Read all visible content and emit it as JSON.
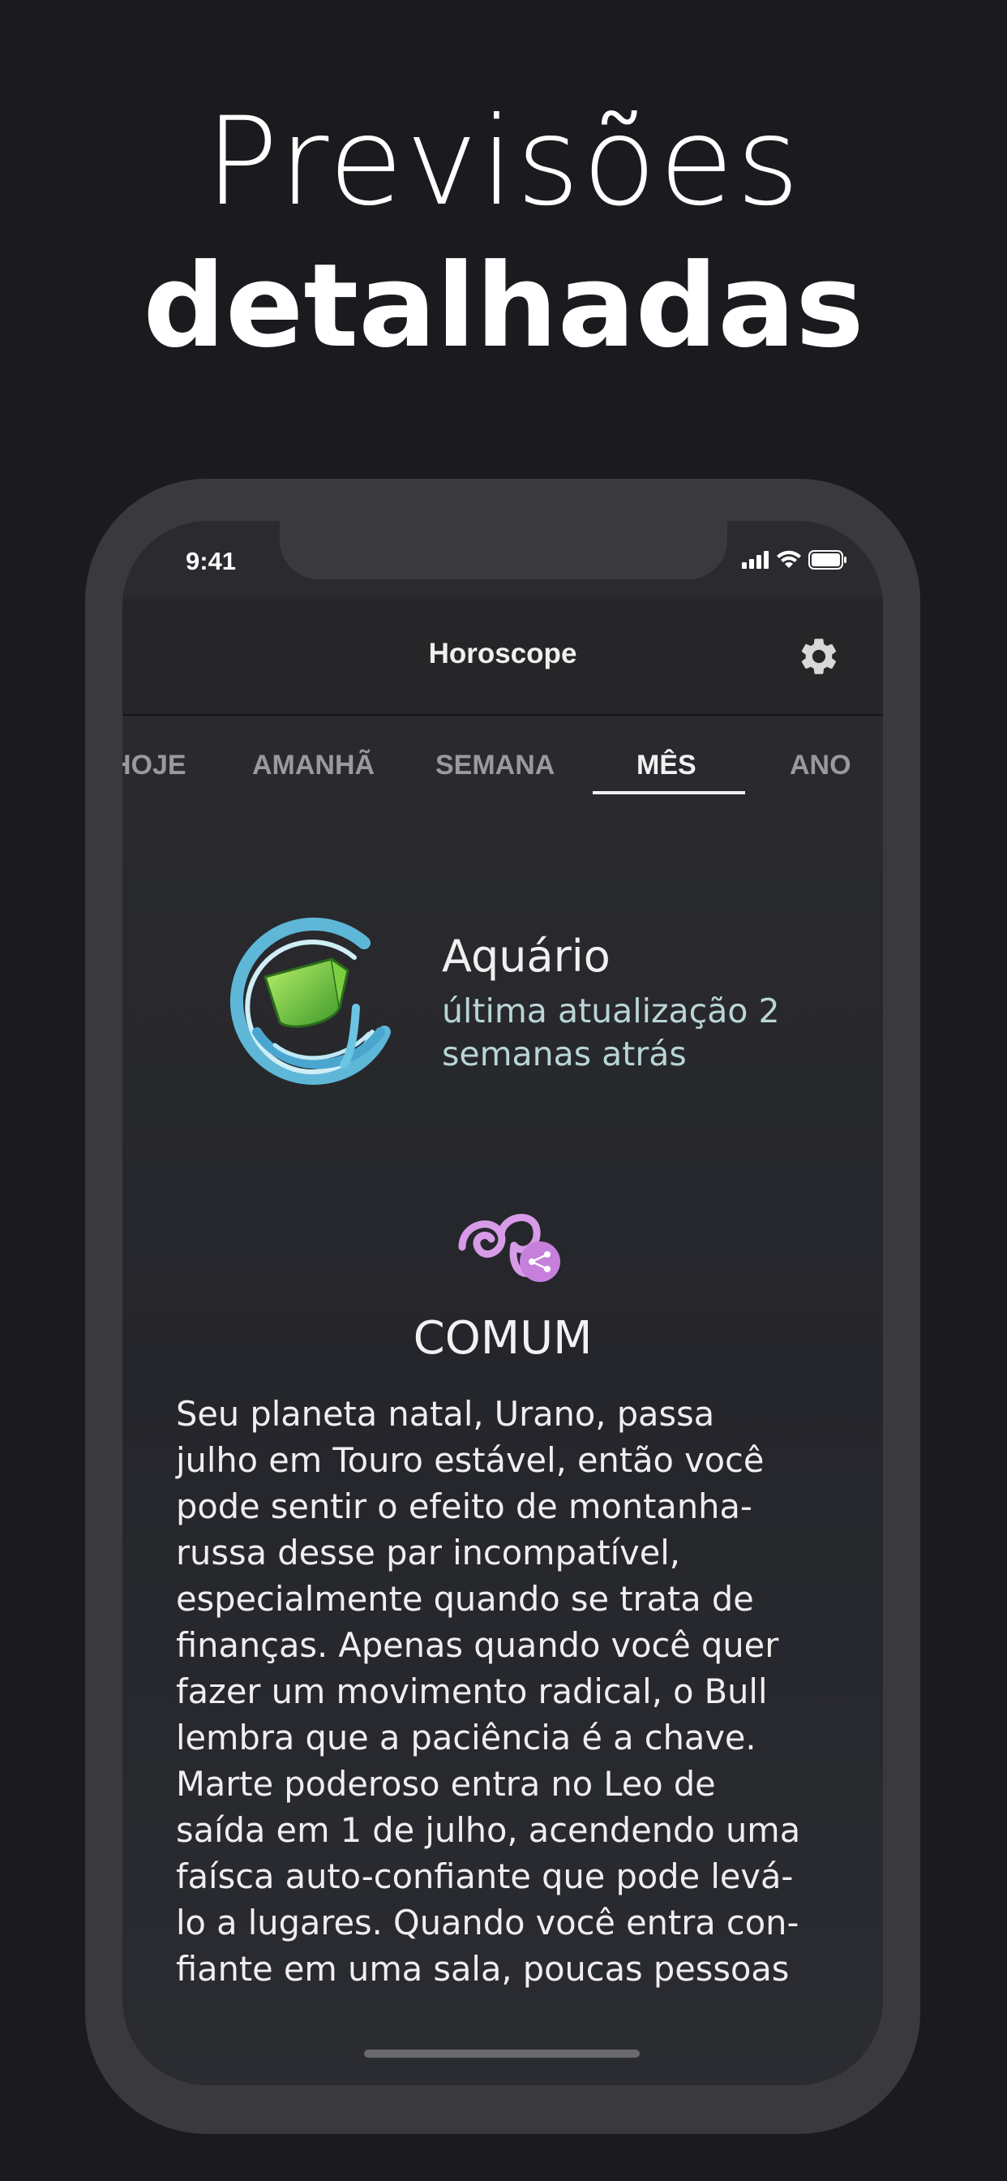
{
  "headline": {
    "line1": "Previsões",
    "line2": "detalhadas"
  },
  "status_bar": {
    "time": "9:41"
  },
  "app_bar": {
    "title": "Horoscope",
    "settings_icon": "gear-icon"
  },
  "tabs": [
    {
      "label": "HOJE",
      "active": false
    },
    {
      "label": "AMANHÃ",
      "active": false
    },
    {
      "label": "SEMANA",
      "active": false
    },
    {
      "label": "MÊS",
      "active": true
    },
    {
      "label": "ANO",
      "active": false
    }
  ],
  "sign": {
    "name": "Aquário",
    "updated": "última atualização 2 semanas atrás",
    "icon": "aquarius-icon"
  },
  "section": {
    "icon": "planets-icon",
    "title": "COMUM",
    "body": "Seu planeta natal, Urano, passa\njulho em Touro estável, então você\npode sentir o efeito de montanha-\nrussa desse par incompatível,\nespecialmente quando se trata de\nfinanças. Apenas quando você quer\nfazer um movimento radical, o Bull\nlembra que a paciência é a chave.\nMarte poderoso entra no Leo de\nsaída em 1 de julho, acendendo uma\nfaísca auto-confiante que pode levá-\nlo a lugares. Quando você entra con-\nfiante em uma sala, poucas pessoas"
  },
  "colors": {
    "background": "#1b1b1f",
    "phone_frame": "#3a3a3d",
    "accent_green": "#6fd14a",
    "accent_pink": "#d79be8"
  }
}
